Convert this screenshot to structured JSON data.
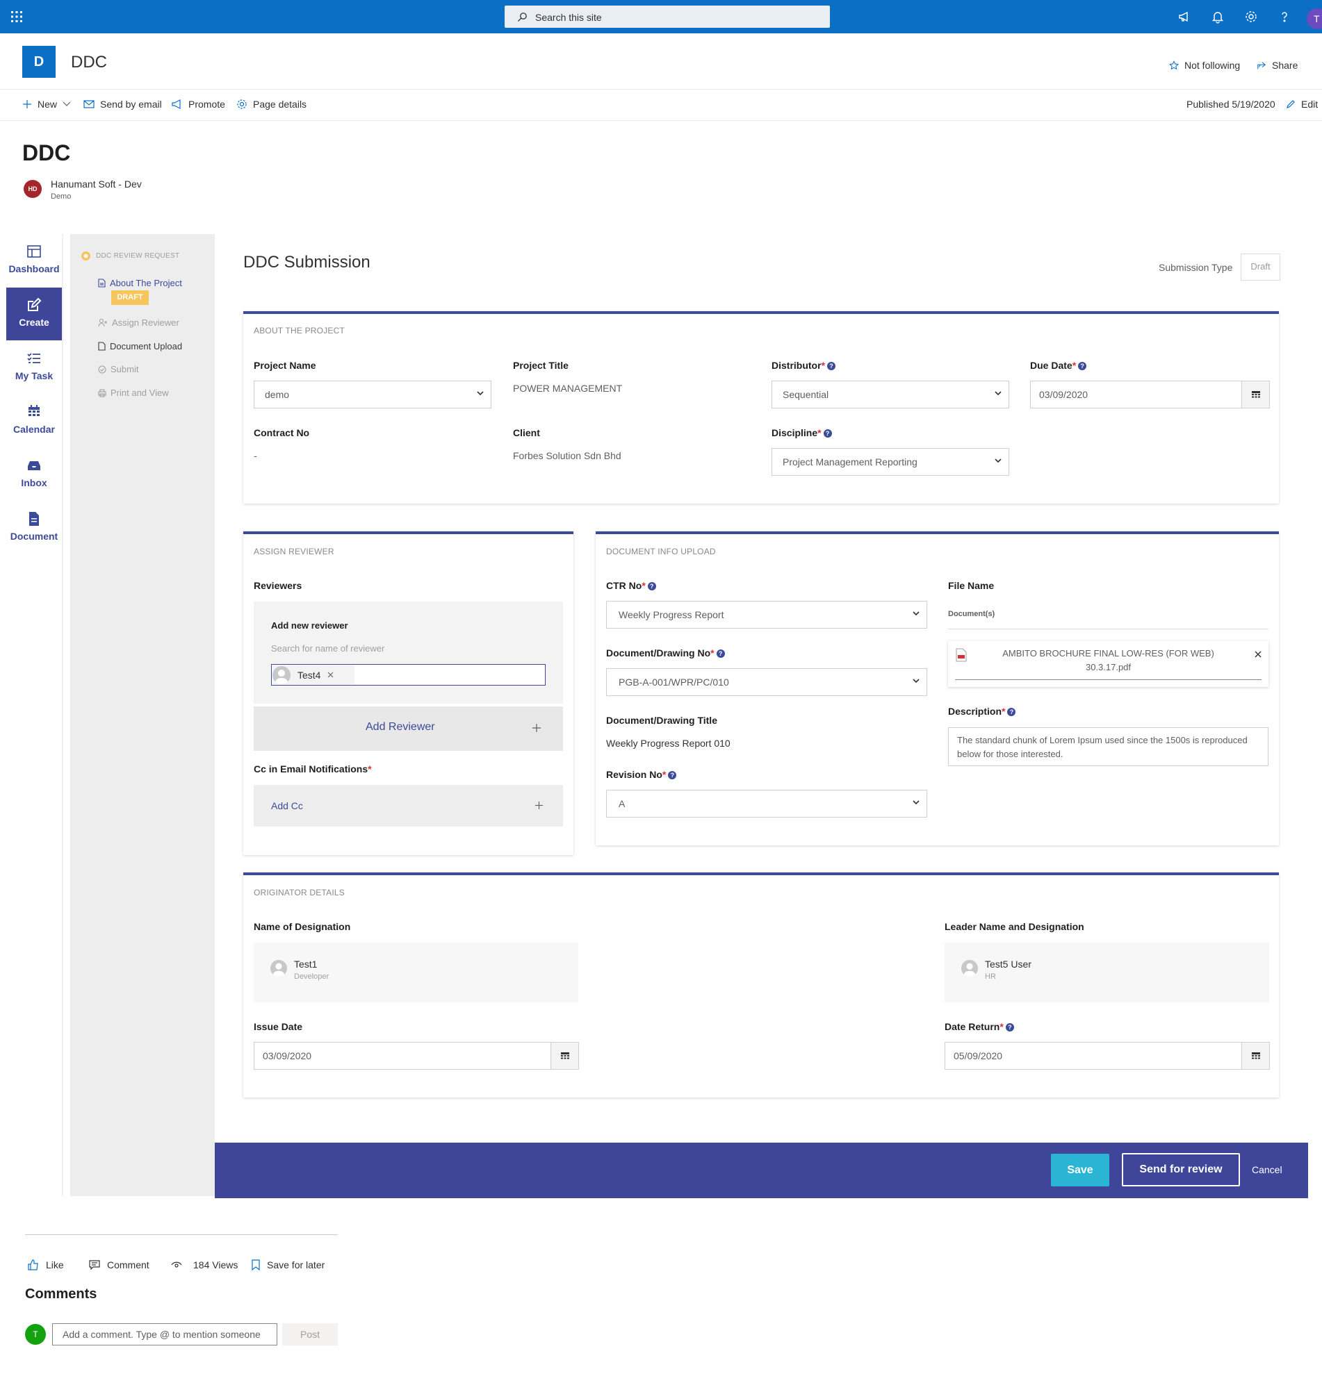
{
  "suite": {
    "search_placeholder": "Search this site",
    "me_initial": "T"
  },
  "site": {
    "logo_letter": "D",
    "title": "DDC",
    "not_following": "Not following",
    "share": "Share"
  },
  "commands": {
    "new": "New",
    "send_by_email": "Send by email",
    "promote": "Promote",
    "page_details": "Page details",
    "published": "Published 5/19/2020",
    "edit": "Edit"
  },
  "page": {
    "title": "DDC",
    "author_initials": "HD",
    "author_name": "Hanumant Soft - Dev",
    "author_role": "Demo"
  },
  "appnav": [
    {
      "label": "Dashboard",
      "icon": "dashboard-icon"
    },
    {
      "label": "Create",
      "icon": "edit-icon",
      "active": true
    },
    {
      "label": "My Task",
      "icon": "task-list-icon"
    },
    {
      "label": "Calendar",
      "icon": "calendar-icon"
    },
    {
      "label": "Inbox",
      "icon": "inbox-icon"
    },
    {
      "label": "Document",
      "icon": "document-icon"
    }
  ],
  "steps": {
    "title": "DDC REVIEW REQUEST",
    "badge": "DRAFT",
    "items": [
      {
        "label": "About The Project",
        "icon": "document-icon",
        "active": true
      },
      {
        "label": "Assign Reviewer",
        "icon": "person-add-icon"
      },
      {
        "label": "Document Upload",
        "icon": "document-icon"
      },
      {
        "label": "Submit",
        "icon": "check-badge-icon"
      },
      {
        "label": "Print and View",
        "icon": "print-icon"
      }
    ]
  },
  "form": {
    "title": "DDC Submission",
    "submission_type_label": "Submission Type",
    "submission_type_value": "Draft"
  },
  "about": {
    "section": "ABOUT THE PROJECT",
    "project_name_label": "Project Name",
    "project_name_value": "demo",
    "project_title_label": "Project Title",
    "project_title_value": "POWER MANAGEMENT",
    "distributor_label": "Distributor",
    "distributor_value": "Sequential",
    "due_date_label": "Due Date",
    "due_date_value": "03/09/2020",
    "contract_no_label": "Contract No",
    "contract_no_value": "-",
    "client_label": "Client",
    "client_value": "Forbes Solution Sdn Bhd",
    "discipline_label": "Discipline",
    "discipline_value": "Project Management Reporting"
  },
  "assign": {
    "section": "ASSIGN REVIEWER",
    "reviewers_label": "Reviewers",
    "add_new_label": "Add new reviewer",
    "search_placeholder": "Search for name of reviewer",
    "selected_reviewer": "Test4",
    "add_reviewer_button": "Add Reviewer",
    "cc_label": "Cc in Email Notifications",
    "add_cc": "Add Cc"
  },
  "docinfo": {
    "section": "DOCUMENT INFO UPLOAD",
    "ctr_label": "CTR No",
    "ctr_value": "Weekly Progress Report",
    "doc_no_label": "Document/Drawing No",
    "doc_no_value": "PGB-A-001/WPR/PC/010",
    "doc_title_label": "Document/Drawing Title",
    "doc_title_value": "Weekly Progress Report 010",
    "revision_label": "Revision No",
    "revision_value": "A",
    "file_name_label": "File Name",
    "documents_label": "Document(s)",
    "file_line1": "AMBITO BROCHURE FINAL LOW-RES (FOR WEB)",
    "file_line2": "30.3.17.pdf",
    "description_label": "Description",
    "description_value": "The standard chunk of Lorem Ipsum used since the 1500s is reproduced below for those interested."
  },
  "originator": {
    "section": "ORIGINATOR DETAILS",
    "designation_label": "Name of Designation",
    "designation_name": "Test1",
    "designation_role": "Developer",
    "leader_label": "Leader Name and Designation",
    "leader_name": "Test5 User",
    "leader_role": "HR",
    "issue_date_label": "Issue Date",
    "issue_date_value": "03/09/2020",
    "date_return_label": "Date Return",
    "date_return_value": "05/09/2020"
  },
  "actions": {
    "save": "Save",
    "send_for_review": "Send for review",
    "cancel": "Cancel"
  },
  "social": {
    "like": "Like",
    "comment": "Comment",
    "views": "184 Views",
    "save_for_later": "Save for later"
  },
  "comments": {
    "title": "Comments",
    "user_initial": "T",
    "placeholder": "Add a comment. Type @ to mention someone",
    "post": "Post"
  },
  "colors": {
    "suite_blue": "#0b6fc6",
    "accent_indigo": "#3f469a",
    "save_cyan": "#29b5d3",
    "draft_yellow": "#f6c55b"
  }
}
